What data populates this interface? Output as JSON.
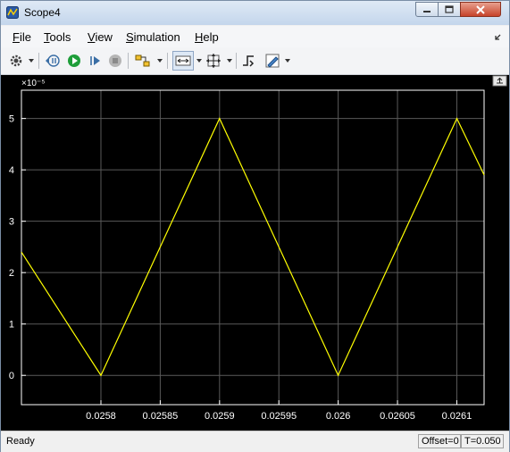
{
  "window": {
    "title": "Scope4"
  },
  "menu": {
    "items": [
      {
        "key": "F",
        "rest": "ile"
      },
      {
        "key": "T",
        "rest": "ools"
      },
      {
        "key": "V",
        "rest": "iew"
      },
      {
        "key": "S",
        "rest": "imulation"
      },
      {
        "key": "H",
        "rest": "elp"
      }
    ]
  },
  "status": {
    "text": "Ready",
    "offset": "Offset=0",
    "time": "T=0.050"
  },
  "colors": {
    "trace": "#ffff00",
    "plot_bg": "#000000",
    "axis": "#ffffff",
    "grid": "#5a5a5a"
  },
  "chart_data": {
    "type": "line",
    "exponent_label": "×10⁻⁵",
    "xlim": [
      0.025733,
      0.026123
    ],
    "ylim": [
      -0.57,
      5.55
    ],
    "xticks": [
      0.0258,
      0.02585,
      0.0259,
      0.02595,
      0.026,
      0.02605,
      0.0261
    ],
    "xtick_labels": [
      "0.0258",
      "0.02585",
      "0.0259",
      "0.02595",
      "0.026",
      "0.02605",
      "0.0261"
    ],
    "yticks": [
      0,
      1,
      2,
      3,
      4,
      5
    ],
    "ytick_labels": [
      "0",
      "1",
      "2",
      "3",
      "4",
      "5"
    ],
    "grid": true,
    "series": [
      {
        "x": [
          0.025733,
          0.0258,
          0.0259,
          0.026,
          0.0261,
          0.026123
        ],
        "y": [
          2.4,
          0,
          5,
          0,
          5,
          3.9
        ]
      }
    ]
  }
}
